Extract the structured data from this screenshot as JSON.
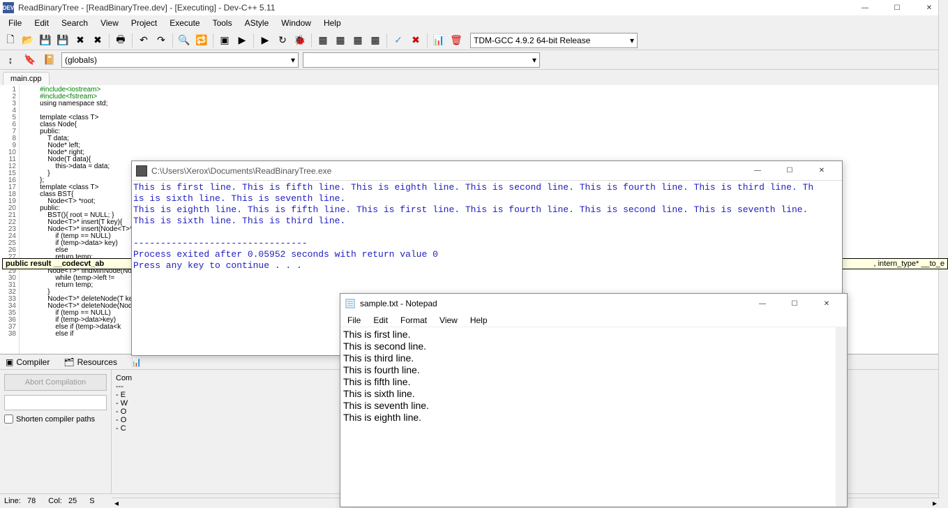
{
  "devcpp": {
    "title": "ReadBinaryTree - [ReadBinaryTree.dev] - [Executing] - Dev-C++ 5.11",
    "menu": [
      "File",
      "Edit",
      "Search",
      "View",
      "Project",
      "Execute",
      "Tools",
      "AStyle",
      "Window",
      "Help"
    ],
    "compiler_combo": "TDM-GCC 4.9.2 64-bit Release",
    "scope_combo": "(globals)",
    "file_tab": "main.cpp",
    "tooltip": "public result __codecvt_ab",
    "tooltip_right": ", intern_type* __to_e",
    "code_lines": [
      {
        "n": 1,
        "t": "#include<iostream>",
        "cls": "pp"
      },
      {
        "n": 2,
        "t": "#include<fstream>",
        "cls": "pp"
      },
      {
        "n": 3,
        "t": "using namespace std;",
        "cls": ""
      },
      {
        "n": 4,
        "t": "",
        "cls": ""
      },
      {
        "n": 5,
        "t": "template <class T>",
        "cls": ""
      },
      {
        "n": 6,
        "t": "class Node{",
        "cls": ""
      },
      {
        "n": 7,
        "t": "public:",
        "cls": ""
      },
      {
        "n": 8,
        "t": "    T data;",
        "cls": ""
      },
      {
        "n": 9,
        "t": "    Node* left;",
        "cls": ""
      },
      {
        "n": 10,
        "t": "    Node* right;",
        "cls": ""
      },
      {
        "n": 11,
        "t": "    Node(T data){",
        "cls": ""
      },
      {
        "n": 12,
        "t": "        this->data = data;",
        "cls": ""
      },
      {
        "n": 15,
        "t": "    }",
        "cls": ""
      },
      {
        "n": 16,
        "t": "};",
        "cls": ""
      },
      {
        "n": 17,
        "t": "template <class T>",
        "cls": ""
      },
      {
        "n": 18,
        "t": "class BST{",
        "cls": ""
      },
      {
        "n": 19,
        "t": "    Node<T> *root;",
        "cls": ""
      },
      {
        "n": 20,
        "t": "public:",
        "cls": ""
      },
      {
        "n": 21,
        "t": "    BST(){ root = NULL; }",
        "cls": ""
      },
      {
        "n": 22,
        "t": "    Node<T>* insert(T key){",
        "cls": ""
      },
      {
        "n": 23,
        "t": "    Node<T>* insert(Node<T>*",
        "cls": ""
      },
      {
        "n": 24,
        "t": "        if (temp == NULL)",
        "cls": ""
      },
      {
        "n": 25,
        "t": "        if (temp->data> key)",
        "cls": ""
      },
      {
        "n": 26,
        "t": "        else",
        "cls": ""
      },
      {
        "n": 27,
        "t": "        return temp;",
        "cls": ""
      },
      {
        "n": 28,
        "t": "    }",
        "cls": ""
      },
      {
        "n": 29,
        "t": "    Node<T>* findMinNode(Node",
        "cls": ""
      },
      {
        "n": 30,
        "t": "        while (temp->left !=",
        "cls": ""
      },
      {
        "n": 31,
        "t": "        return temp;",
        "cls": ""
      },
      {
        "n": 32,
        "t": "    }",
        "cls": ""
      },
      {
        "n": 33,
        "t": "    Node<T>* deleteNode(T key",
        "cls": ""
      },
      {
        "n": 34,
        "t": "    Node<T>* deleteNode(Node<",
        "cls": ""
      },
      {
        "n": 35,
        "t": "        if (temp == NULL)",
        "cls": ""
      },
      {
        "n": 36,
        "t": "        if (temp->data>key)",
        "cls": ""
      },
      {
        "n": 37,
        "t": "        else if (temp->data<k",
        "cls": ""
      },
      {
        "n": 38,
        "t": "        else if",
        "cls": ""
      }
    ],
    "bottom_tabs": [
      "Compiler",
      "Resources"
    ],
    "abort_btn": "Abort Compilation",
    "shorten_check": "Shorten compiler paths",
    "compile_header": "Com",
    "compile_lines": [
      "- E",
      "- W",
      "- O",
      "- O",
      "- C"
    ],
    "status": {
      "line_label": "Line:",
      "line": "78",
      "col_label": "Col:",
      "col": "25",
      "sel": "S"
    }
  },
  "console": {
    "title": "C:\\Users\\Xerox\\Documents\\ReadBinaryTree.exe",
    "output": "This is first line. This is fifth line. This is eighth line. This is second line. This is fourth line. This is third line. Th\nis is sixth line. This is seventh line.\nThis is eighth line. This is fifth line. This is first line. This is fourth line. This is second line. This is seventh line.\nThis is sixth line. This is third line.\n\n--------------------------------\nProcess exited after 0.05952 seconds with return value 0\nPress any key to continue . . ."
  },
  "notepad": {
    "title": "sample.txt - Notepad",
    "menu": [
      "File",
      "Edit",
      "Format",
      "View",
      "Help"
    ],
    "lines": [
      "This is first line.",
      "This is second line.",
      "This is third line.",
      "This is fourth line.",
      "This is fifth line.",
      "This is sixth line.",
      "This is seventh line.",
      "This is eighth line."
    ]
  }
}
